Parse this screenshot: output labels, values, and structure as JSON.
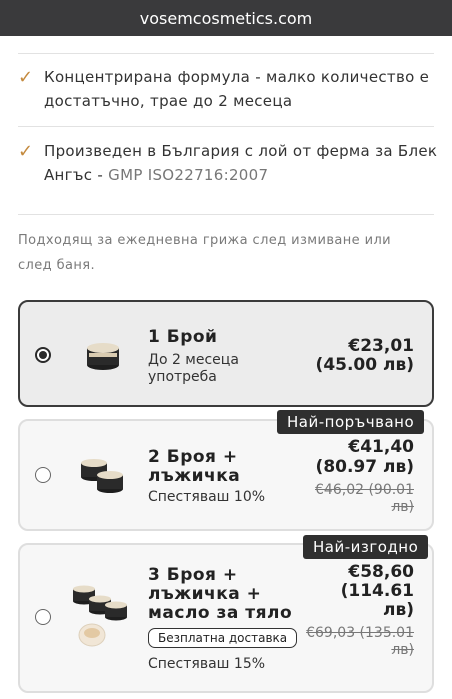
{
  "browser": {
    "url": "vosemcosmetics.com"
  },
  "features": [
    {
      "text": "Концентрирана формула - малко количество е достатъчно, трае до 2 месеца",
      "muted": ""
    },
    {
      "text": "Произведен в България с лой от ферма за Блек Ангъс - ",
      "muted": "GMP ISO22716:2007"
    }
  ],
  "note": "Подходящ за ежедневна грижа след измиване или след баня.",
  "options": [
    {
      "title": "1 Брой",
      "subtitle": "До 2 месеца употреба",
      "price": "€23,01",
      "price_bgn": "(45.00 лв)",
      "selected": true
    },
    {
      "badge": "Най-поръчвано",
      "title": "2 Броя + лъжичка",
      "subtitle": "Спестяваш 10%",
      "price": "€41,40",
      "price_bgn": "(80.97 лв)",
      "old_price": "€46,02 (90.01 лв)",
      "selected": false
    },
    {
      "badge": "Най-изгодно",
      "title": "3 Броя + лъжичка + масло за тяло",
      "pill": "Безплатна доставка",
      "subtitle": "Спестяваш 15%",
      "price": "€58,60",
      "price_bgn": "(114.61 лв)",
      "old_price": "€69,03 (135.01 лв)",
      "selected": false
    }
  ]
}
